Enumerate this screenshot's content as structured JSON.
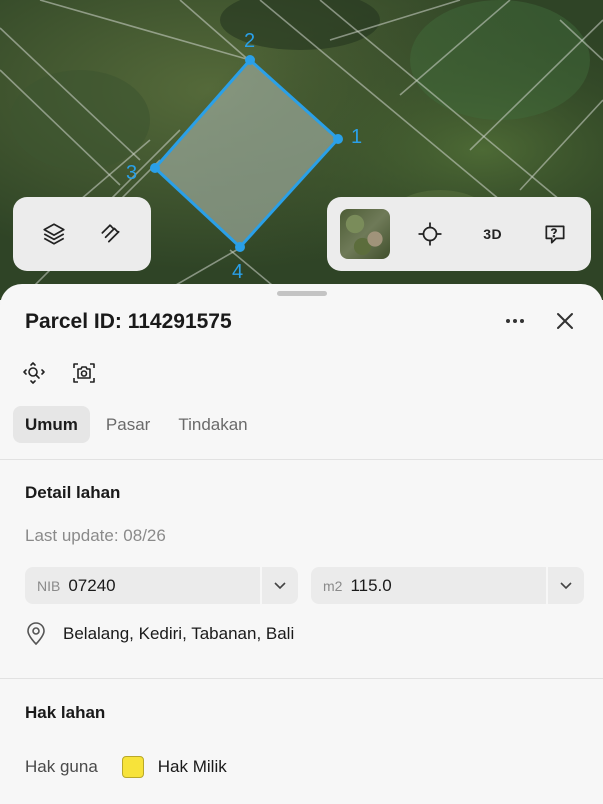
{
  "map": {
    "vertex_labels": [
      "1",
      "2",
      "3",
      "4"
    ],
    "colors": {
      "parcel_outline": "#2aa0e8",
      "parcel_fill": "#9aa89a"
    }
  },
  "toolbar": {
    "layers_icon": "layers-icon",
    "measure_icon": "measure-icon",
    "basemap_icon": "satellite-thumbnail",
    "locate_icon": "crosshair-icon",
    "view_3d_label": "3D",
    "feedback_icon": "chat-icon"
  },
  "sheet": {
    "title": "Parcel ID: 114291575",
    "tabs": [
      "Umum",
      "Pasar",
      "Tindakan"
    ],
    "active_tab": "Umum",
    "detail": {
      "heading": "Detail lahan",
      "last_update": "Last update: 08/26",
      "nib_prefix": "NIB",
      "nib_value": "07240",
      "area_prefix": "m2",
      "area_value": "115.0",
      "address": "Belalang, Kediri, Tabanan, Bali"
    },
    "rights": {
      "heading": "Hak lahan",
      "label": "Hak guna",
      "value": "Hak Milik",
      "swatch_color": "#f7e33a"
    }
  }
}
